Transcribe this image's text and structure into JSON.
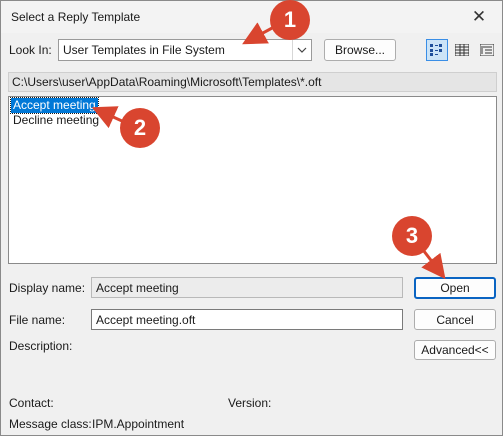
{
  "window": {
    "title": "Select a Reply Template",
    "close_glyph": "✕"
  },
  "look_in": {
    "label": "Look In:",
    "value": "User Templates in File System",
    "browse_label": "Browse..."
  },
  "view_buttons": [
    "large-icons-view",
    "list-view",
    "details-view"
  ],
  "path": "C:\\Users\\user\\AppData\\Roaming\\Microsoft\\Templates\\*.oft",
  "templates": [
    {
      "name": "Accept meeting",
      "selected": true
    },
    {
      "name": "Decline meeting",
      "selected": false
    }
  ],
  "form": {
    "display_name_label": "Display name:",
    "display_name_value": "Accept meeting",
    "file_name_label": "File name:",
    "file_name_value": "Accept meeting.oft",
    "description_label": "Description:",
    "contact_label": "Contact:",
    "version_label": "Version:",
    "message_class_label": "Message class:",
    "message_class_value": "IPM.Appointment"
  },
  "buttons": {
    "open": "Open",
    "cancel": "Cancel",
    "advanced": "Advanced<<"
  },
  "annotations": [
    "1",
    "2",
    "3"
  ],
  "colors": {
    "annotation": "#d9452f",
    "selection": "#0078d7",
    "default_button_border": "#0a64c2"
  }
}
